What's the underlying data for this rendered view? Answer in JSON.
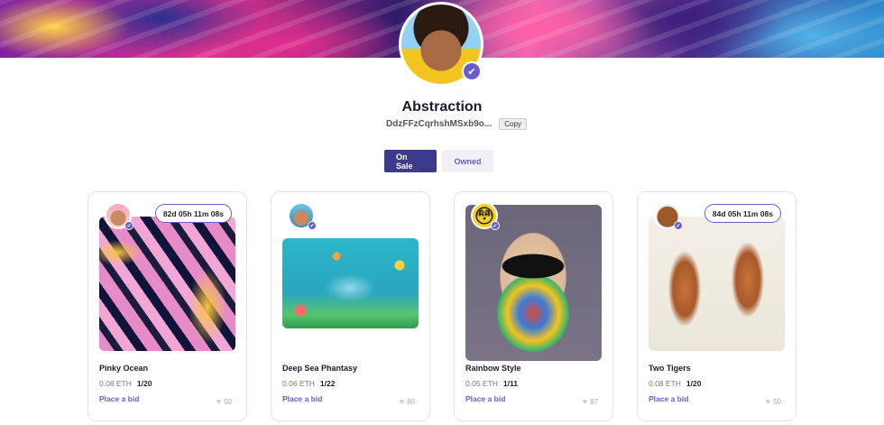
{
  "profile": {
    "name": "Abstraction",
    "address": "DdzFFzCqrhshMSxb9o...",
    "copy_label": "Copy"
  },
  "tabs": [
    {
      "label": "On Sale"
    },
    {
      "label": "Owned"
    }
  ],
  "cards": [
    {
      "title": "Pinky Ocean",
      "price": "0.08 ETH",
      "edition": "1/20",
      "bid_label": "Place a bid",
      "likes": "50",
      "timer": "82d 05h 11m 08s"
    },
    {
      "title": "Deep Sea Phantasy",
      "price": "0.06 ETH",
      "edition": "1/22",
      "bid_label": "Place a bid",
      "likes": "80",
      "timer": ""
    },
    {
      "title": "Rainbow Style",
      "price": "0.05 ETH",
      "edition": "1/11",
      "bid_label": "Place a bid",
      "likes": "87",
      "timer": ""
    },
    {
      "title": "Two Tigers",
      "price": "0.08 ETH",
      "edition": "1/20",
      "bid_label": "Place a bid",
      "likes": "50",
      "timer": "84d 05h 11m 08s"
    }
  ],
  "colors": {
    "accent": "#6a5cd0",
    "primary_button": "#3b3a8c",
    "text_dark": "#1b1b2f"
  },
  "icons": {
    "verified": "check-icon",
    "like": "heart-icon"
  }
}
